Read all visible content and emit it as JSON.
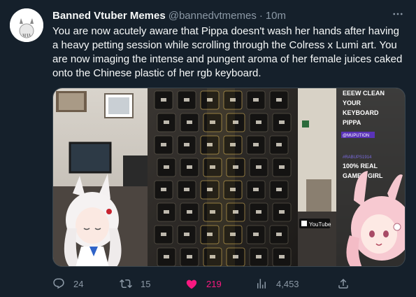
{
  "author": {
    "display_name": "Banned Vtuber Memes",
    "handle": "@bannedvtmemes",
    "separator": "·",
    "time": "10m"
  },
  "tweet_text": "You are now acutely aware that Pippa doesn't wash her hands after having a heavy petting session while scrolling through the Colress x Lumi art. You are now imaging the intense and pungent aroma of her female juices caked onto the Chinese plastic of her rgb keyboard.",
  "media": {
    "chat_lines": [
      "EEEW CLEAN",
      "YOUR",
      "KEYBOARD",
      "PIPPA"
    ],
    "chat_username_1": "@MUPUTION",
    "chat_username_2": "#RABUPS1914",
    "chat_lines_2": [
      "100% REAL",
      "GAMER GIRL"
    ],
    "youtube_label": "YouTube"
  },
  "actions": {
    "reply_count": "24",
    "retweet_count": "15",
    "like_count": "219",
    "view_count": "4,453"
  },
  "colors": {
    "background": "#15202b",
    "text": "#f7f9f9",
    "muted": "#8b98a5",
    "like": "#f91880"
  }
}
